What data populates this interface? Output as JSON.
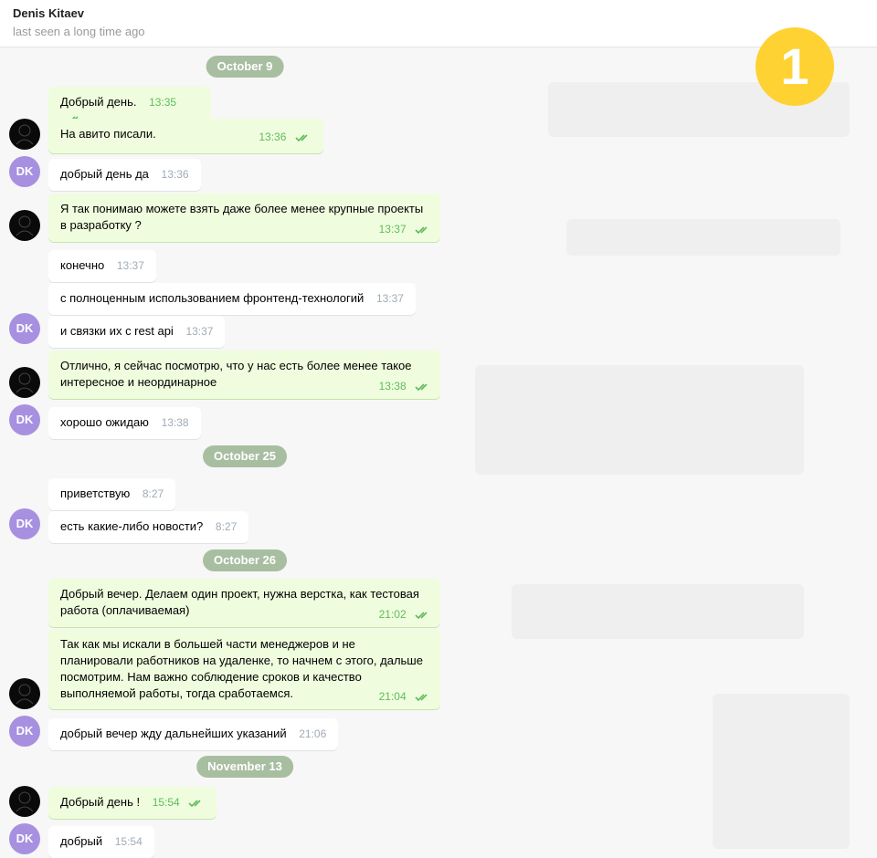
{
  "header": {
    "contact_name": "Denis Kitaev",
    "status": "last seen a long time ago"
  },
  "page_badge": "1",
  "avatar_initials": "DK",
  "dates": {
    "d1": "October 9",
    "d2": "October 25",
    "d3": "October 26",
    "d4": "November 13"
  },
  "messages": {
    "m1": {
      "text": "Добрый день.",
      "time": "13:35",
      "direction": "outgoing",
      "read": true
    },
    "m2": {
      "text": "На авито писали.",
      "time": "13:36",
      "direction": "outgoing",
      "read": true
    },
    "m3": {
      "text": "добрый день да",
      "time": "13:36",
      "direction": "incoming"
    },
    "m4": {
      "text": "Я так понимаю можете взять даже более менее крупные проекты в разработку ?",
      "time": "13:37",
      "direction": "outgoing",
      "read": true
    },
    "m5": {
      "text": "конечно",
      "time": "13:37",
      "direction": "incoming"
    },
    "m6": {
      "text": "с полноценным использованием фронтенд-технологий",
      "time": "13:37",
      "direction": "incoming"
    },
    "m7": {
      "text": "и связки их с rest api",
      "time": "13:37",
      "direction": "incoming"
    },
    "m8": {
      "text": "Отлично, я сейчас посмотрю, что у нас есть более менее такое интересное и неординарное",
      "time": "13:38",
      "direction": "outgoing",
      "read": true
    },
    "m9": {
      "text": "хорошо ожидаю",
      "time": "13:38",
      "direction": "incoming"
    },
    "m10": {
      "text": "приветствую",
      "time": "8:27",
      "direction": "incoming"
    },
    "m11": {
      "text": "есть какие-либо новости?",
      "time": "8:27",
      "direction": "incoming"
    },
    "m12": {
      "text": "Добрый вечер. Делаем один проект, нужна верстка, как тестовая работа (оплачиваемая)",
      "time": "21:02",
      "direction": "outgoing",
      "read": true
    },
    "m13": {
      "text": "Так как мы искали в большей части менеджеров и не планировали работников на удаленке, то начнем с этого, дальше посмотрим. Нам важно соблюдение сроков и качество выполняемой работы, тогда сработаемся.",
      "time": "21:04",
      "direction": "outgoing",
      "read": true
    },
    "m14": {
      "text": "добрый вечер жду дальнейших указаний",
      "time": "21:06",
      "direction": "incoming"
    },
    "m15": {
      "text": "Добрый день !",
      "time": "15:54",
      "direction": "outgoing",
      "read": true
    },
    "m16": {
      "text": "добрый",
      "time": "15:54",
      "direction": "incoming"
    }
  },
  "colors": {
    "outgoing_bubble": "#effdde",
    "incoming_bubble": "#ffffff",
    "date_pill": "#a8bea1",
    "avatar_dk": "#a790e0",
    "read_checks": "#5fbc5b",
    "badge": "#ffd233"
  },
  "icons": {
    "read_receipt": "double-check-icon"
  }
}
